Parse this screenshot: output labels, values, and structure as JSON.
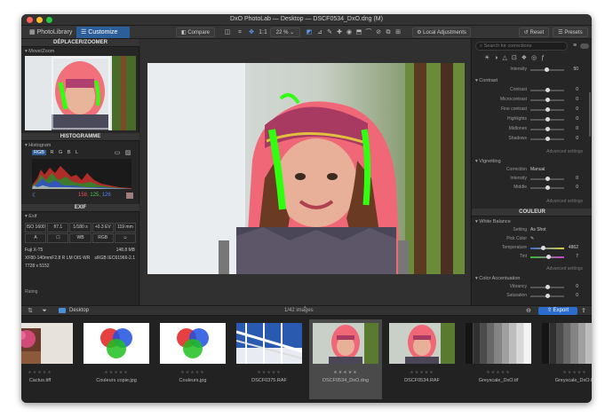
{
  "window": {
    "title": "DxO PhotoLab — Desktop — DSCF0534_DxO.dng (M)",
    "close_color": "#ff5f57",
    "min_color": "#febc2e",
    "max_color": "#28c840"
  },
  "toolbar": {
    "tab_library": "PhotoLibrary",
    "tab_customize": "Customize",
    "compare": "Compare",
    "zoom_fit": "1:1",
    "zoom": "22 %",
    "local_adjustments": "Local Adjustments",
    "reset": "Reset",
    "presets": "Presets"
  },
  "left": {
    "move_zoom_header": "DÉPLACER/ZOOMER",
    "move_zoom_sub": "Move/Zoom",
    "hist_header": "HISTOGRAMME",
    "hist_sub": "Histogram",
    "hist_channels": [
      "RGB",
      "R",
      "G",
      "B",
      "L"
    ],
    "hist_values": {
      "r": "158,",
      "g": "125,",
      "b": "126"
    },
    "exif_header": "EXIF",
    "exif_sub": "Exif",
    "exif_grid": [
      "ISO 1600",
      "f/7.1",
      "1/180 s",
      "+0.3 EV",
      "119 mm"
    ],
    "exif_grid2": [
      "A",
      "☐",
      "WB",
      "RGB",
      "☺"
    ],
    "camera": "Fuji X-T5",
    "filesize": "148.8 MB",
    "lens": "XF80-140mmF2.8 R LM OIS WR",
    "colorspace": "sRGB IEC61966-2.1",
    "dimensions": "7728 x 5152",
    "rating_label": "Rating"
  },
  "right": {
    "search_placeholder": "Search for corrections",
    "intensity_top": {
      "label": "Intensity",
      "value": "50"
    },
    "contrast_title": "Contrast",
    "contrast_rows": [
      {
        "label": "Contrast",
        "value": "0"
      },
      {
        "label": "Microcontrast",
        "value": "0"
      },
      {
        "label": "Fine contrast",
        "value": "0"
      },
      {
        "label": "Highlights",
        "value": "0"
      },
      {
        "label": "Midtones",
        "value": "0"
      },
      {
        "label": "Shadows",
        "value": "0"
      }
    ],
    "advanced": "Advanced settings",
    "vignetting_title": "Vignetting",
    "vignetting_rows": [
      {
        "label": "Correction",
        "value": "Manual"
      },
      {
        "label": "Intensity",
        "value": "0"
      },
      {
        "label": "Middle",
        "value": "0"
      }
    ],
    "couleur_header": "COULEUR",
    "wb_title": "White Balance",
    "wb_rows": [
      {
        "label": "Setting",
        "value": "As Shot"
      },
      {
        "label": "Pick Color",
        "value": ""
      },
      {
        "label": "Temperature",
        "value": "4862"
      },
      {
        "label": "Tint",
        "value": "7"
      }
    ],
    "color_acc_title": "Color Accentuation",
    "color_acc_rows": [
      {
        "label": "Vibrancy",
        "value": "0"
      },
      {
        "label": "Saturation",
        "value": "0"
      }
    ]
  },
  "bottom": {
    "folder": "Desktop",
    "count": "1/42 images",
    "export": "Export"
  },
  "film": [
    {
      "name": "Cactus.tiff",
      "kind": "cactus"
    },
    {
      "name": "Couleurs copie.jpg",
      "kind": "rgb"
    },
    {
      "name": "Couleurs.jpg",
      "kind": "rgb"
    },
    {
      "name": "DSCF0375.RAF",
      "kind": "arch"
    },
    {
      "name": "DSCF0534_DxO.dng",
      "kind": "girl"
    },
    {
      "name": "DSCF0534.RAF",
      "kind": "girl"
    },
    {
      "name": "Greyscale_DxO.tif",
      "kind": "grey"
    },
    {
      "name": "Greyscale_DxO.tif",
      "kind": "grey2"
    }
  ]
}
